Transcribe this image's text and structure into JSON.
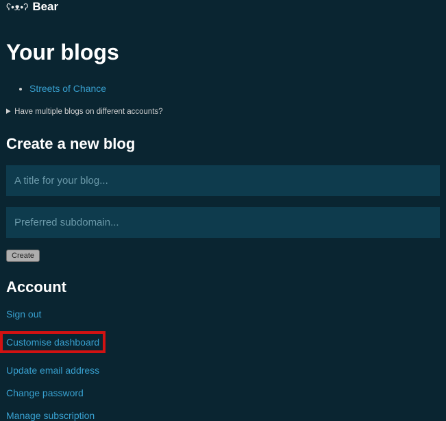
{
  "header": {
    "logo_glyph": "ʕ•ᴥ•ʔ",
    "logo_text": "Bear"
  },
  "sections": {
    "blogs": {
      "heading": "Your blogs",
      "items": [
        "Streets of Chance"
      ],
      "multi_account_summary": "Have multiple blogs on different accounts?"
    },
    "create": {
      "heading": "Create a new blog",
      "title_placeholder": "A title for your blog...",
      "subdomain_placeholder": "Preferred subdomain...",
      "create_label": "Create"
    },
    "account": {
      "heading": "Account",
      "links": {
        "sign_out": "Sign out",
        "customise_dashboard": "Customise dashboard",
        "update_email": "Update email address",
        "change_password": "Change password",
        "manage_subscription": "Manage subscription"
      }
    }
  }
}
